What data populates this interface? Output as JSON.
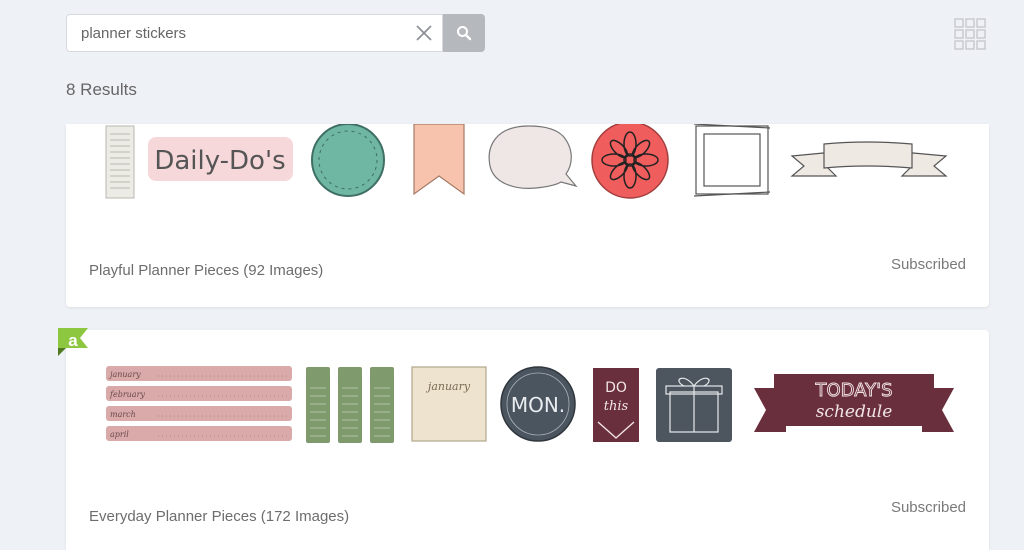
{
  "search": {
    "value": "planner stickers",
    "placeholder": "Search"
  },
  "results": {
    "count_label": "8 Results"
  },
  "cards": [
    {
      "title": "Playful Planner Pieces (92 Images)",
      "status": "Subscribed",
      "preview_label": "Daily-Do's"
    },
    {
      "title": "Everyday Planner Pieces (172 Images)",
      "status": "Subscribed",
      "badge": "a",
      "preview_texts": {
        "month1": "january",
        "month2": "february",
        "month3": "march",
        "month4": "april",
        "square_month": "january",
        "day": "MON.",
        "do_line1": "DO",
        "do_line2": "this",
        "banner_line1": "TODAY'S",
        "banner_line2": "schedule"
      }
    }
  ],
  "colors": {
    "accent_green": "#8dc63f",
    "pink": "#f6d7da",
    "teal": "#6fb6a3",
    "peach": "#f8c3ac",
    "coral": "#ef5d5d",
    "rose": "#d9aaa9",
    "sage": "#7f9a6c",
    "tan": "#eee3cf",
    "slate": "#4b5560",
    "maroon": "#6a2f3c",
    "gift_gray": "#4d555e"
  },
  "icons": {
    "clear": "close-icon",
    "search": "search-icon",
    "view": "grid-icon"
  }
}
